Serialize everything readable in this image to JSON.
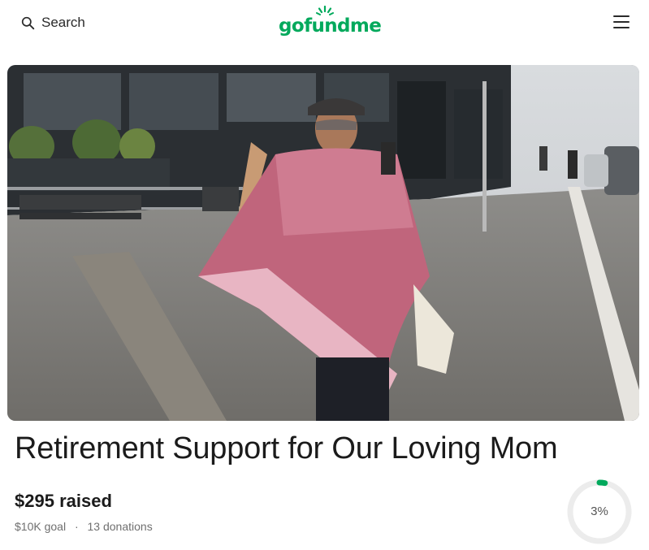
{
  "header": {
    "search_label": "Search",
    "logo_text": "gofundme",
    "logo_icon": "gofundme-sun-icon",
    "menu_icon": "hamburger-menu-icon"
  },
  "hero": {
    "image_alt": "Woman in pink shawl standing outside airport terminal"
  },
  "campaign": {
    "title": "Retirement Support for Our Loving Mom",
    "raised_amount": "$295",
    "raised_word": "raised",
    "goal": "$10K goal",
    "separator": "·",
    "donations": "13 donations",
    "progress_percent": 3,
    "progress_label": "3%"
  },
  "colors": {
    "brand_green": "#02a95c",
    "ring_track": "#ececec",
    "text_dark": "#1b1b1b",
    "text_muted": "#6f6f6f"
  }
}
